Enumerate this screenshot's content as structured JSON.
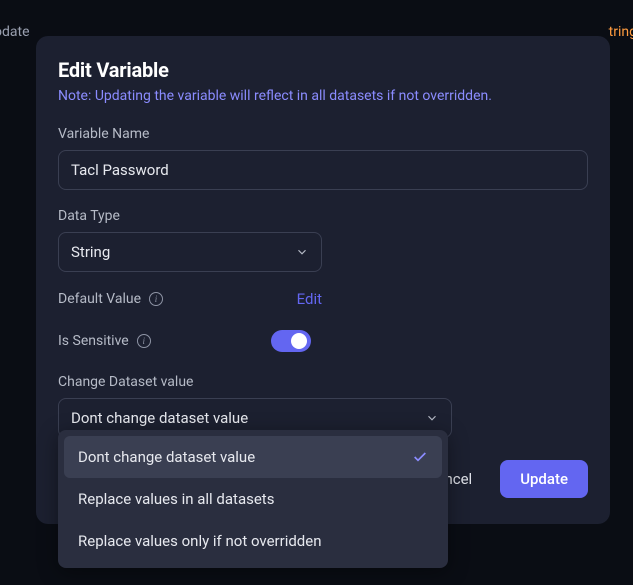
{
  "bg": {
    "left": "odate",
    "right": "tring"
  },
  "modal": {
    "title": "Edit Variable",
    "note": "Note: Updating the variable will reflect in all datasets if not overridden.",
    "fields": {
      "variable_name": {
        "label": "Variable Name",
        "value": "Tacl Password"
      },
      "data_type": {
        "label": "Data Type",
        "selected": "String"
      },
      "default_value": {
        "label": "Default Value",
        "edit": "Edit"
      },
      "is_sensitive": {
        "label": "Is Sensitive",
        "on": true
      },
      "change_dataset": {
        "label": "Change Dataset value",
        "selected": "Dont change dataset value"
      }
    },
    "actions": {
      "cancel": "Cancel",
      "update": "Update"
    }
  },
  "dropdown": {
    "items": [
      {
        "label": "Dont change dataset value",
        "selected": true
      },
      {
        "label": "Replace values in all datasets",
        "selected": false
      },
      {
        "label": "Replace values only if not overridden",
        "selected": false
      }
    ]
  }
}
